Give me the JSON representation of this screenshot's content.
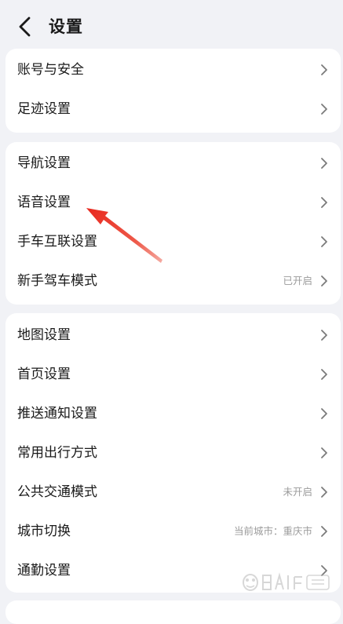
{
  "header": {
    "back_icon": "chevron-left-icon",
    "title": "设置"
  },
  "groups": [
    {
      "items": [
        {
          "label": "账号与安全",
          "value": ""
        },
        {
          "label": "足迹设置",
          "value": ""
        }
      ]
    },
    {
      "items": [
        {
          "label": "导航设置",
          "value": ""
        },
        {
          "label": "语音设置",
          "value": ""
        },
        {
          "label": "手车互联设置",
          "value": ""
        },
        {
          "label": "新手驾车模式",
          "value": "已开启"
        }
      ]
    },
    {
      "items": [
        {
          "label": "地图设置",
          "value": ""
        },
        {
          "label": "首页设置",
          "value": ""
        },
        {
          "label": "推送通知设置",
          "value": ""
        },
        {
          "label": "常用出行方式",
          "value": ""
        },
        {
          "label": "公共交通模式",
          "value": "未开启"
        },
        {
          "label": "城市切换",
          "value": "当前城市：重庆市"
        },
        {
          "label": "通勤设置",
          "value": ""
        }
      ]
    }
  ],
  "annotation": {
    "type": "red-arrow",
    "color": "#e8281e",
    "points_to": "语音设置"
  },
  "colors": {
    "background": "#f1f2f6",
    "card": "#ffffff",
    "text": "#1a1a1a",
    "secondary_text": "#9b9b9b",
    "chevron": "#7a7a7a"
  }
}
